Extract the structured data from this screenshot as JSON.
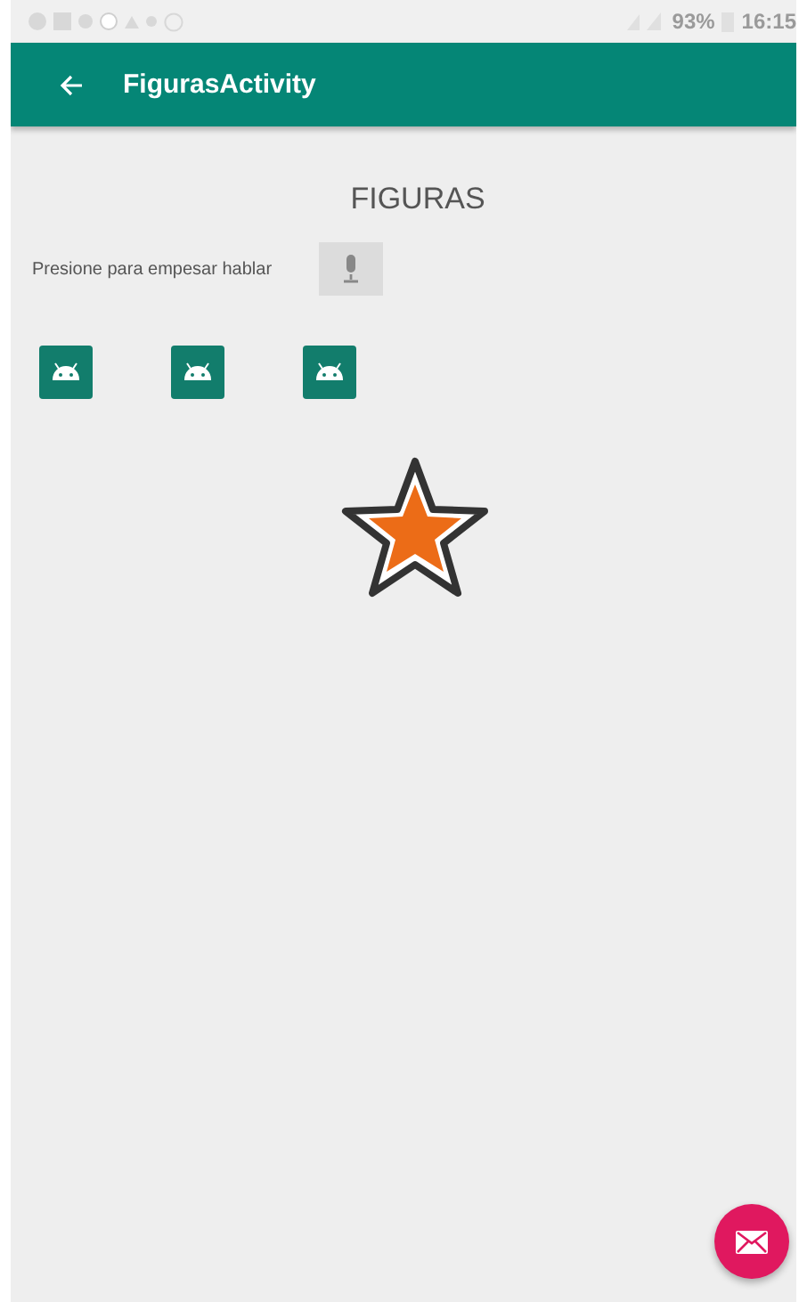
{
  "status_bar": {
    "battery": "93%",
    "time": "16:15"
  },
  "app_bar": {
    "title": "FigurasActivity"
  },
  "heading": "FIGURAS",
  "speech": {
    "prompt": "Presione para empesar hablar"
  }
}
